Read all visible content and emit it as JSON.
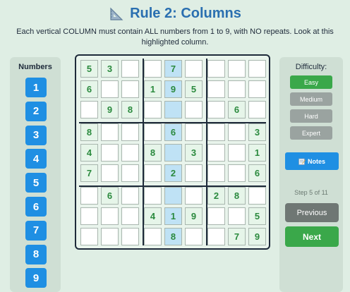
{
  "header": {
    "title": "Rule 2: Columns",
    "icon": "ruler-triangle-icon",
    "instruction": "Each vertical COLUMN must contain ALL numbers from 1 to 9, with NO repeats. Look at this highlighted column."
  },
  "numbers_panel": {
    "title": "Numbers",
    "buttons": [
      "1",
      "2",
      "3",
      "4",
      "5",
      "6",
      "7",
      "8",
      "9"
    ]
  },
  "board": {
    "highlighted_column": 5,
    "rows": [
      [
        "5",
        "3",
        "",
        "",
        "7",
        "",
        "",
        "",
        ""
      ],
      [
        "6",
        "",
        "",
        "1",
        "9",
        "5",
        "",
        "",
        ""
      ],
      [
        "",
        "9",
        "8",
        "",
        "",
        "",
        "",
        "6",
        ""
      ],
      [
        "8",
        "",
        "",
        "",
        "6",
        "",
        "",
        "",
        "3"
      ],
      [
        "4",
        "",
        "",
        "8",
        "",
        "3",
        "",
        "",
        "1"
      ],
      [
        "7",
        "",
        "",
        "",
        "2",
        "",
        "",
        "",
        "6"
      ],
      [
        "",
        "6",
        "",
        "",
        "",
        "",
        "2",
        "8",
        ""
      ],
      [
        "",
        "",
        "",
        "4",
        "1",
        "9",
        "",
        "",
        "5"
      ],
      [
        "",
        "",
        "",
        "",
        "8",
        "",
        "",
        "7",
        "9"
      ]
    ]
  },
  "difficulty": {
    "title": "Difficulty:",
    "options": [
      "Easy",
      "Medium",
      "Hard",
      "Expert"
    ],
    "selected": "Easy"
  },
  "controls": {
    "notes_label": "Notes",
    "notes_icon": "pencil-note-icon",
    "step_text": "Step 5 of 11",
    "previous_label": "Previous",
    "next_label": "Next"
  },
  "colors": {
    "accent_blue": "#1f8fe3",
    "title_blue": "#2a6fb0",
    "green": "#3aa84a",
    "highlight": "#bfe2f5",
    "given_cell": "#e6f5e9"
  }
}
